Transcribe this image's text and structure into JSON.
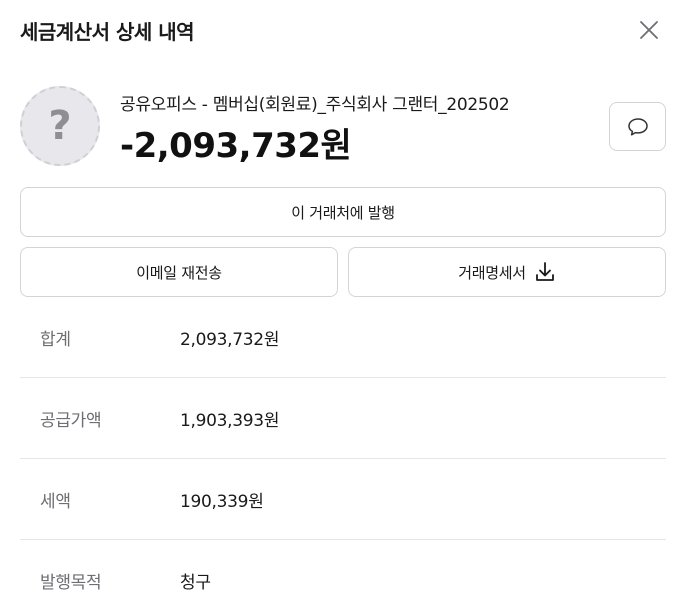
{
  "header": {
    "title": "세금계산서 상세 내역",
    "close_icon": "close-icon"
  },
  "vendor": {
    "avatar_icon": "question-mark-icon",
    "avatar_glyph": "?",
    "name": "공유오피스 - 멤버십(회원료)_주식회사 그랜터_202502",
    "amount": "-2,093,732원",
    "comment_icon": "speech-bubble-icon"
  },
  "actions": {
    "issue_label": "이 거래처에 발행",
    "resend_label": "이메일 재전송",
    "statement_label": "거래명세서",
    "download_icon": "download-icon"
  },
  "details": [
    {
      "label": "합계",
      "value": "2,093,732원"
    },
    {
      "label": "공급가액",
      "value": "1,903,393원"
    },
    {
      "label": "세액",
      "value": "190,339원"
    },
    {
      "label": "발행목적",
      "value": "청구"
    }
  ]
}
